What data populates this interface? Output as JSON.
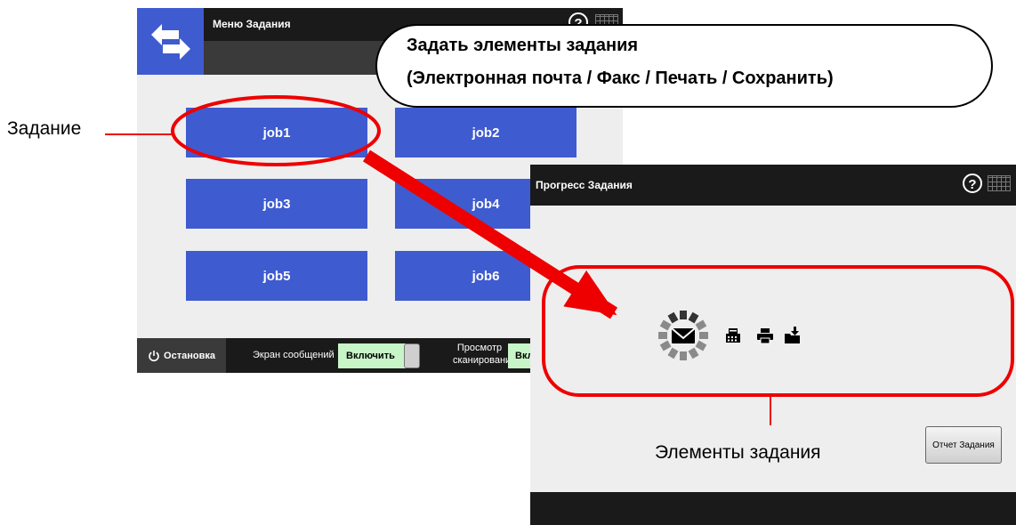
{
  "job_menu": {
    "title": "Меню Задания",
    "back_icon": "swap-arrows-icon",
    "jobs": [
      {
        "label": "job1"
      },
      {
        "label": "job2"
      },
      {
        "label": "job3"
      },
      {
        "label": "job4"
      },
      {
        "label": "job5"
      },
      {
        "label": "job6"
      }
    ],
    "footer": {
      "stop_label": "Остановка",
      "message_screen_label": "Экран сообщений",
      "message_screen_toggle": "Включить",
      "scan_preview_label_line1": "Просмотр",
      "scan_preview_label_line2": "сканирования",
      "scan_preview_toggle": "Вкл"
    }
  },
  "job_progress": {
    "title": "Прогресс Задания",
    "report_button": "Отчет Задания",
    "items": [
      "email-icon",
      "fax-icon",
      "print-icon",
      "save-icon"
    ]
  },
  "annotations": {
    "callout_line1": "Задать элементы задания",
    "callout_line2": "(Электронная почта / Факс / Печать / Сохранить)",
    "job_label": "Задание",
    "job_items_label": "Элементы задания"
  },
  "colors": {
    "accent_blue": "#3f5bd0",
    "toggle_green": "#c8f5c8",
    "highlight_red": "#ee0000",
    "titlebar": "#1a1a1a",
    "background": "#eeeeee"
  }
}
